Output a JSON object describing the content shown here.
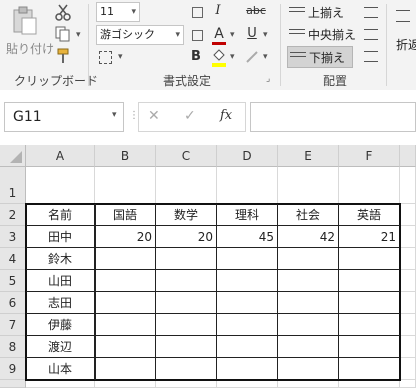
{
  "ribbon": {
    "clipboard": {
      "paste_label": "貼り付け",
      "group_label": "クリップボード"
    },
    "font": {
      "size": "11",
      "name": "游ゴシック",
      "italic": "I",
      "bold": "B",
      "underline": "U",
      "strike": "abc",
      "font_color_glyph": "A",
      "group_label": "書式設定",
      "colors": {
        "font_color": "#c00000",
        "fill_color": "#ffff00"
      }
    },
    "alignment": {
      "top_align": "上揃え",
      "middle_align": "中央揃え",
      "bottom_align": "下揃え",
      "group_label": "配置",
      "wrap_label": "折返"
    }
  },
  "formula_bar": {
    "name_box": "G11",
    "cancel_glyph": "✕",
    "enter_glyph": "✓",
    "fx_glyph": "fx",
    "formula": ""
  },
  "sheet": {
    "columns": [
      "A",
      "B",
      "C",
      "D",
      "E",
      "F"
    ],
    "rows": [
      "1",
      "2",
      "3",
      "4",
      "5",
      "6",
      "7",
      "8",
      "9"
    ],
    "header_row": [
      "名前",
      "国語",
      "数学",
      "理科",
      "社会",
      "英語"
    ],
    "names": [
      "田中",
      "鈴木",
      "山田",
      "志田",
      "伊藤",
      "渡辺",
      "山本"
    ],
    "first_scores": [
      "20",
      "20",
      "45",
      "42",
      "21"
    ]
  }
}
